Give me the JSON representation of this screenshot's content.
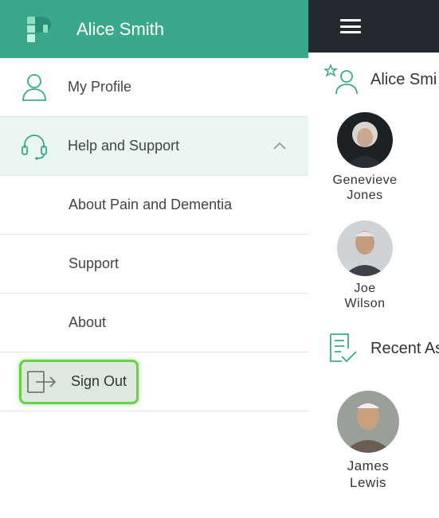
{
  "drawer": {
    "user_name": "Alice Smith",
    "items": [
      {
        "label": "My Profile",
        "icon": "user-icon"
      },
      {
        "label": "Help and Support",
        "icon": "headset-icon",
        "expanded": true
      },
      {
        "label": "About Pain and Dementia"
      },
      {
        "label": "Support"
      },
      {
        "label": "About"
      }
    ],
    "sign_out_label": "Sign Out",
    "colors": {
      "header": "#3aa98a",
      "expanded_bg": "#e9f6f2",
      "highlight_border": "#6ccf4a"
    }
  },
  "app": {
    "section_residents": "Alice Smi",
    "section_recent": "Recent As",
    "residents": [
      {
        "first": "Genevieve",
        "last": "Jones"
      },
      {
        "first": "Joe",
        "last": "Wilson"
      }
    ],
    "recent": [
      {
        "first": "James",
        "last": "Lewis"
      }
    ],
    "colors": {
      "topbar": "#232a2e",
      "accent": "#3aa98a"
    }
  }
}
